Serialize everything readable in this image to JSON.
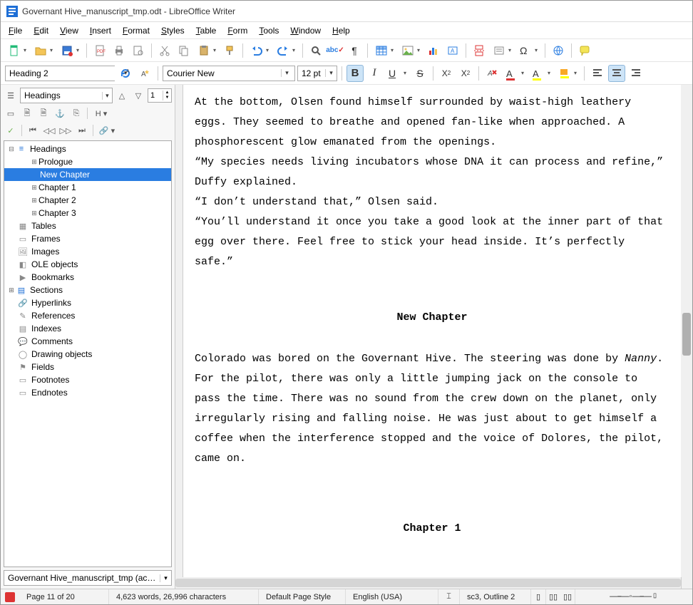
{
  "window": {
    "title": "Governant Hive_manuscript_tmp.odt - LibreOffice Writer"
  },
  "menu": {
    "items": [
      "File",
      "Edit",
      "View",
      "Insert",
      "Format",
      "Styles",
      "Table",
      "Form",
      "Tools",
      "Window",
      "Help"
    ]
  },
  "format": {
    "para_style": "Heading 2",
    "font_name": "Courier New",
    "font_size": "12 pt"
  },
  "navigator": {
    "mode": "Headings",
    "level": "1",
    "headings_root": "Headings",
    "headings": [
      "Prologue",
      "New Chapter",
      "Chapter 1",
      "Chapter 2",
      "Chapter 3"
    ],
    "categories": [
      "Tables",
      "Frames",
      "Images",
      "OLE objects",
      "Bookmarks",
      "Sections",
      "Hyperlinks",
      "References",
      "Indexes",
      "Comments",
      "Drawing objects",
      "Fields",
      "Footnotes",
      "Endnotes"
    ],
    "active_doc": "Governant Hive_manuscript_tmp (active)"
  },
  "document": {
    "para1": "  At the bottom, Olsen found himself surrounded by waist-high leathery eggs. They seemed to breathe and opened fan-like when approached. A phosphorescent glow emanated from the openings.",
    "para2": "  “My species needs living incubators whose DNA it can process and refine,” Duffy explained.",
    "para3": "  “I don’t understand that,” Olsen said.",
    "para4": "  “You’ll understand it once you take a good look at the inner part of that egg over there. Feel free to stick your head inside. It’s perfectly safe.”",
    "heading_new": "New Chapter",
    "para5_a": "Colorado was bored on the Governant Hive. The steering was done by ",
    "para5_em": "Nanny",
    "para5_b": ". For the pilot, there was only a little jumping jack on the console to pass the time. There was no sound from the crew down on the planet, only irregularly rising and falling noise. He was just about to get himself a coffee when the interference stopped and the voice of Dolores, the pilot, came on.",
    "heading_ch1": "Chapter 1"
  },
  "status": {
    "page": "Page 11 of 20",
    "words": "4,623 words, 26,996 characters",
    "page_style": "Default Page Style",
    "lang": "English (USA)",
    "sel": "sc3, Outline 2"
  }
}
